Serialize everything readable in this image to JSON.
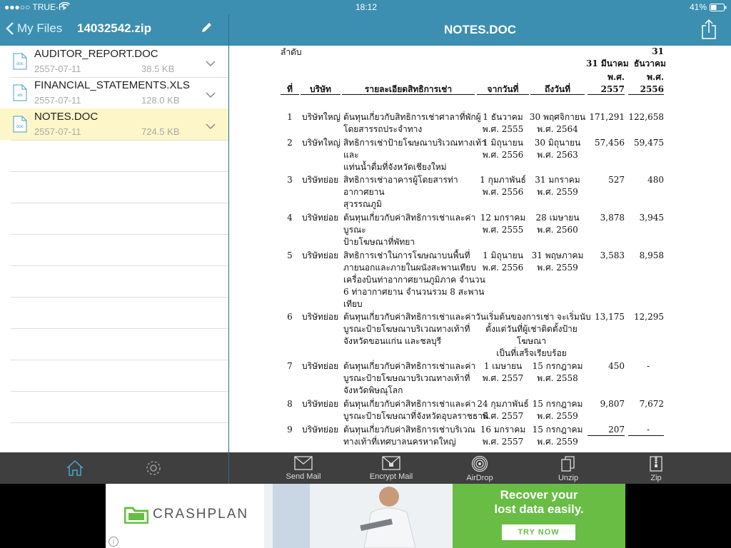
{
  "status": {
    "carrier": "●●●○○ TRUE-H",
    "time": "18:12",
    "battery": "41%"
  },
  "left_nav": {
    "back_label": "My Files",
    "zip_name": "14032542.zip"
  },
  "right_nav": {
    "doc_title": "NOTES.DOC"
  },
  "files": [
    {
      "name": "AUDITOR_REPORT.DOC",
      "date": "2557-07-11",
      "size": "38.5 KB",
      "icon_label": "doc",
      "selected": false
    },
    {
      "name": "FINANCIAL_STATEMENTS.XLS",
      "date": "2557-07-11",
      "size": "128.0 KB",
      "icon_label": "xls",
      "selected": false
    },
    {
      "name": "NOTES.DOC",
      "date": "2557-07-11",
      "size": "724.5 KB",
      "icon_label": "doc",
      "selected": true
    }
  ],
  "doc": {
    "header": {
      "seq_label": "ลำดับ",
      "seq_no": "ที่",
      "company": "บริษัท",
      "details": "รายละเอียดสิทธิการเช่า",
      "from_date": "จากวันที่",
      "to_date": "ถึงวันที่",
      "col1_top": "31 มีนาคม",
      "col1_mid": "พ.ศ.",
      "col1_year": "2557",
      "col2_num": "31",
      "col2_month": "ธันวาคม",
      "col2_mid": "พ.ศ.",
      "col2_year": "2556"
    },
    "rows": [
      {
        "no": "1",
        "company": "บริษัทใหญ่",
        "detail": [
          "ต้นทุนเกี่ยวกับสิทธิการเช่าศาลาที่พักผู้",
          "โดยสารรถประจำทาง"
        ],
        "from": [
          "1 ธันวาคม",
          "พ.ศ. 2555"
        ],
        "to": [
          "30 พฤศจิกายน",
          "พ.ศ. 2564"
        ],
        "v1": "171,291",
        "v2": "122,658"
      },
      {
        "no": "2",
        "company": "บริษัทใหญ่",
        "detail": [
          "สิทธิการเช่าป้ายโฆษณาบริเวณทางเท้า",
          "และ",
          "แท่นน้ำดื่มที่จังหวัดเชียงใหม่"
        ],
        "from": [
          "1 มิถุนายน",
          "พ.ศ. 2556"
        ],
        "to": [
          "30 มิถุนายน",
          "พ.ศ. 2563"
        ],
        "v1": "57,456",
        "v2": "59,475"
      },
      {
        "no": "3",
        "company": "บริษัทย่อย",
        "detail": [
          "สิทธิการเช่าอาคารผู้โดยสารท่า",
          "อากาศยาน",
          "สุวรรณภูมิ"
        ],
        "from": [
          "1 กุมภาพันธ์",
          "พ.ศ. 2556"
        ],
        "to": [
          "31 มกราคม",
          "พ.ศ. 2559"
        ],
        "v1": "527",
        "v2": "480"
      },
      {
        "no": "4",
        "company": "บริษัทย่อย",
        "detail": [
          "ต้นทุนเกี่ยวกับค่าสิทธิการเช่าและค่า",
          "บูรณะ",
          "ป้ายโฆษณาที่พัทยา"
        ],
        "from": [
          "12 มกราคม",
          "พ.ศ. 2555"
        ],
        "to": [
          "28 เมษายน",
          "พ.ศ. 2560"
        ],
        "v1": "3,878",
        "v2": "3,945"
      },
      {
        "no": "5",
        "company": "บริษัทย่อย",
        "detail": [
          "สิทธิการเช่าในการโฆษณาบนพื้นที่",
          "ภายนอกและภายในผนังสะพานเทียบ",
          "เครื่องบินท่าอากาศยานภูมิภาค จำนวน",
          "6 ท่าอากาศยาน จำนวนรวม 8 สะพาน",
          "เทียบ"
        ],
        "from": [
          "1 มิถุนายน",
          "พ.ศ. 2556"
        ],
        "to": [
          "31 พฤษภาคม",
          "พ.ศ. 2559"
        ],
        "v1": "3,583",
        "v2": "8,958"
      },
      {
        "no": "6",
        "company": "บริษัทย่อย",
        "detail": [
          "ต้นทุนเกี่ยวกับค่าสิทธิการเช่าและค่า",
          "บูรณะป้ายโฆษณาบริเวณทางเท้าที่",
          "จังหวัดขอนแก่น และชลบุรี"
        ],
        "span": [
          "วันเริ่มต้นของการเช่า จะเริ่มนับ",
          "ตั้งแต่วันที่ผู้เช่าติดตั้งป้าย",
          "โฆษณา",
          "เป็นที่เสร็จเรียบร้อย"
        ],
        "v1": "13,175",
        "v2": "12,295"
      },
      {
        "no": "7",
        "company": "บริษัทย่อย",
        "detail": [
          "ต้นทุนเกี่ยวกับค่าสิทธิการเช่าและค่า",
          "บูรณะป้ายโฆษณาบริเวณทางเท้าที่",
          "จังหวัดพิษณุโลก"
        ],
        "from": [
          "1 เมษายน",
          "พ.ศ. 2557"
        ],
        "to": [
          "15 กรกฎาคม",
          "พ.ศ. 2558"
        ],
        "v1": "450",
        "v2": "-"
      },
      {
        "no": "8",
        "company": "บริษัทย่อย",
        "detail": [
          "ต้นทุนเกี่ยวกับค่าสิทธิการเช่าและค่า",
          "บูรณะป้ายโฆษณาที่จังหวัดอุบลราชธานี"
        ],
        "from": [
          "24 กุมภาพันธ์",
          "พ.ศ. 2557"
        ],
        "to": [
          "15 กรกฎาคม",
          "พ.ศ. 2559"
        ],
        "v1": "9,807",
        "v2": "7,672"
      },
      {
        "no": "9",
        "company": "บริษัทย่อย",
        "detail": [
          "ต้นทุนเกี่ยวกับค่าสิทธิการเช่าบริเวณ",
          "ทางเท้าที่เทศบาลนครหาดใหญ่"
        ],
        "from": [
          "16 มกราคม",
          "พ.ศ. 2557"
        ],
        "to": [
          "15 กรกฎาคม",
          "พ.ศ. 2559"
        ],
        "v1": "207",
        "v2": "-"
      }
    ]
  },
  "toolbar": [
    {
      "label": "Send Mail",
      "icon": "mail-icon"
    },
    {
      "label": "Encrypt Mail",
      "icon": "encrypt-mail-icon"
    },
    {
      "label": "AirDrop",
      "icon": "airdrop-icon"
    },
    {
      "label": "Unzip",
      "icon": "unzip-icon"
    },
    {
      "label": "Zip",
      "icon": "zip-icon"
    }
  ],
  "ad": {
    "brand": "CRASHPLAN",
    "headline_1": "Recover your",
    "headline_2": "lost data easily.",
    "cta": "TRY NOW",
    "info": "i"
  },
  "colors": {
    "accent": "#3c8fb0",
    "selected_row": "#fcf6c8",
    "toolbar": "#3f3f3f",
    "ad_green": "#69bd45"
  }
}
